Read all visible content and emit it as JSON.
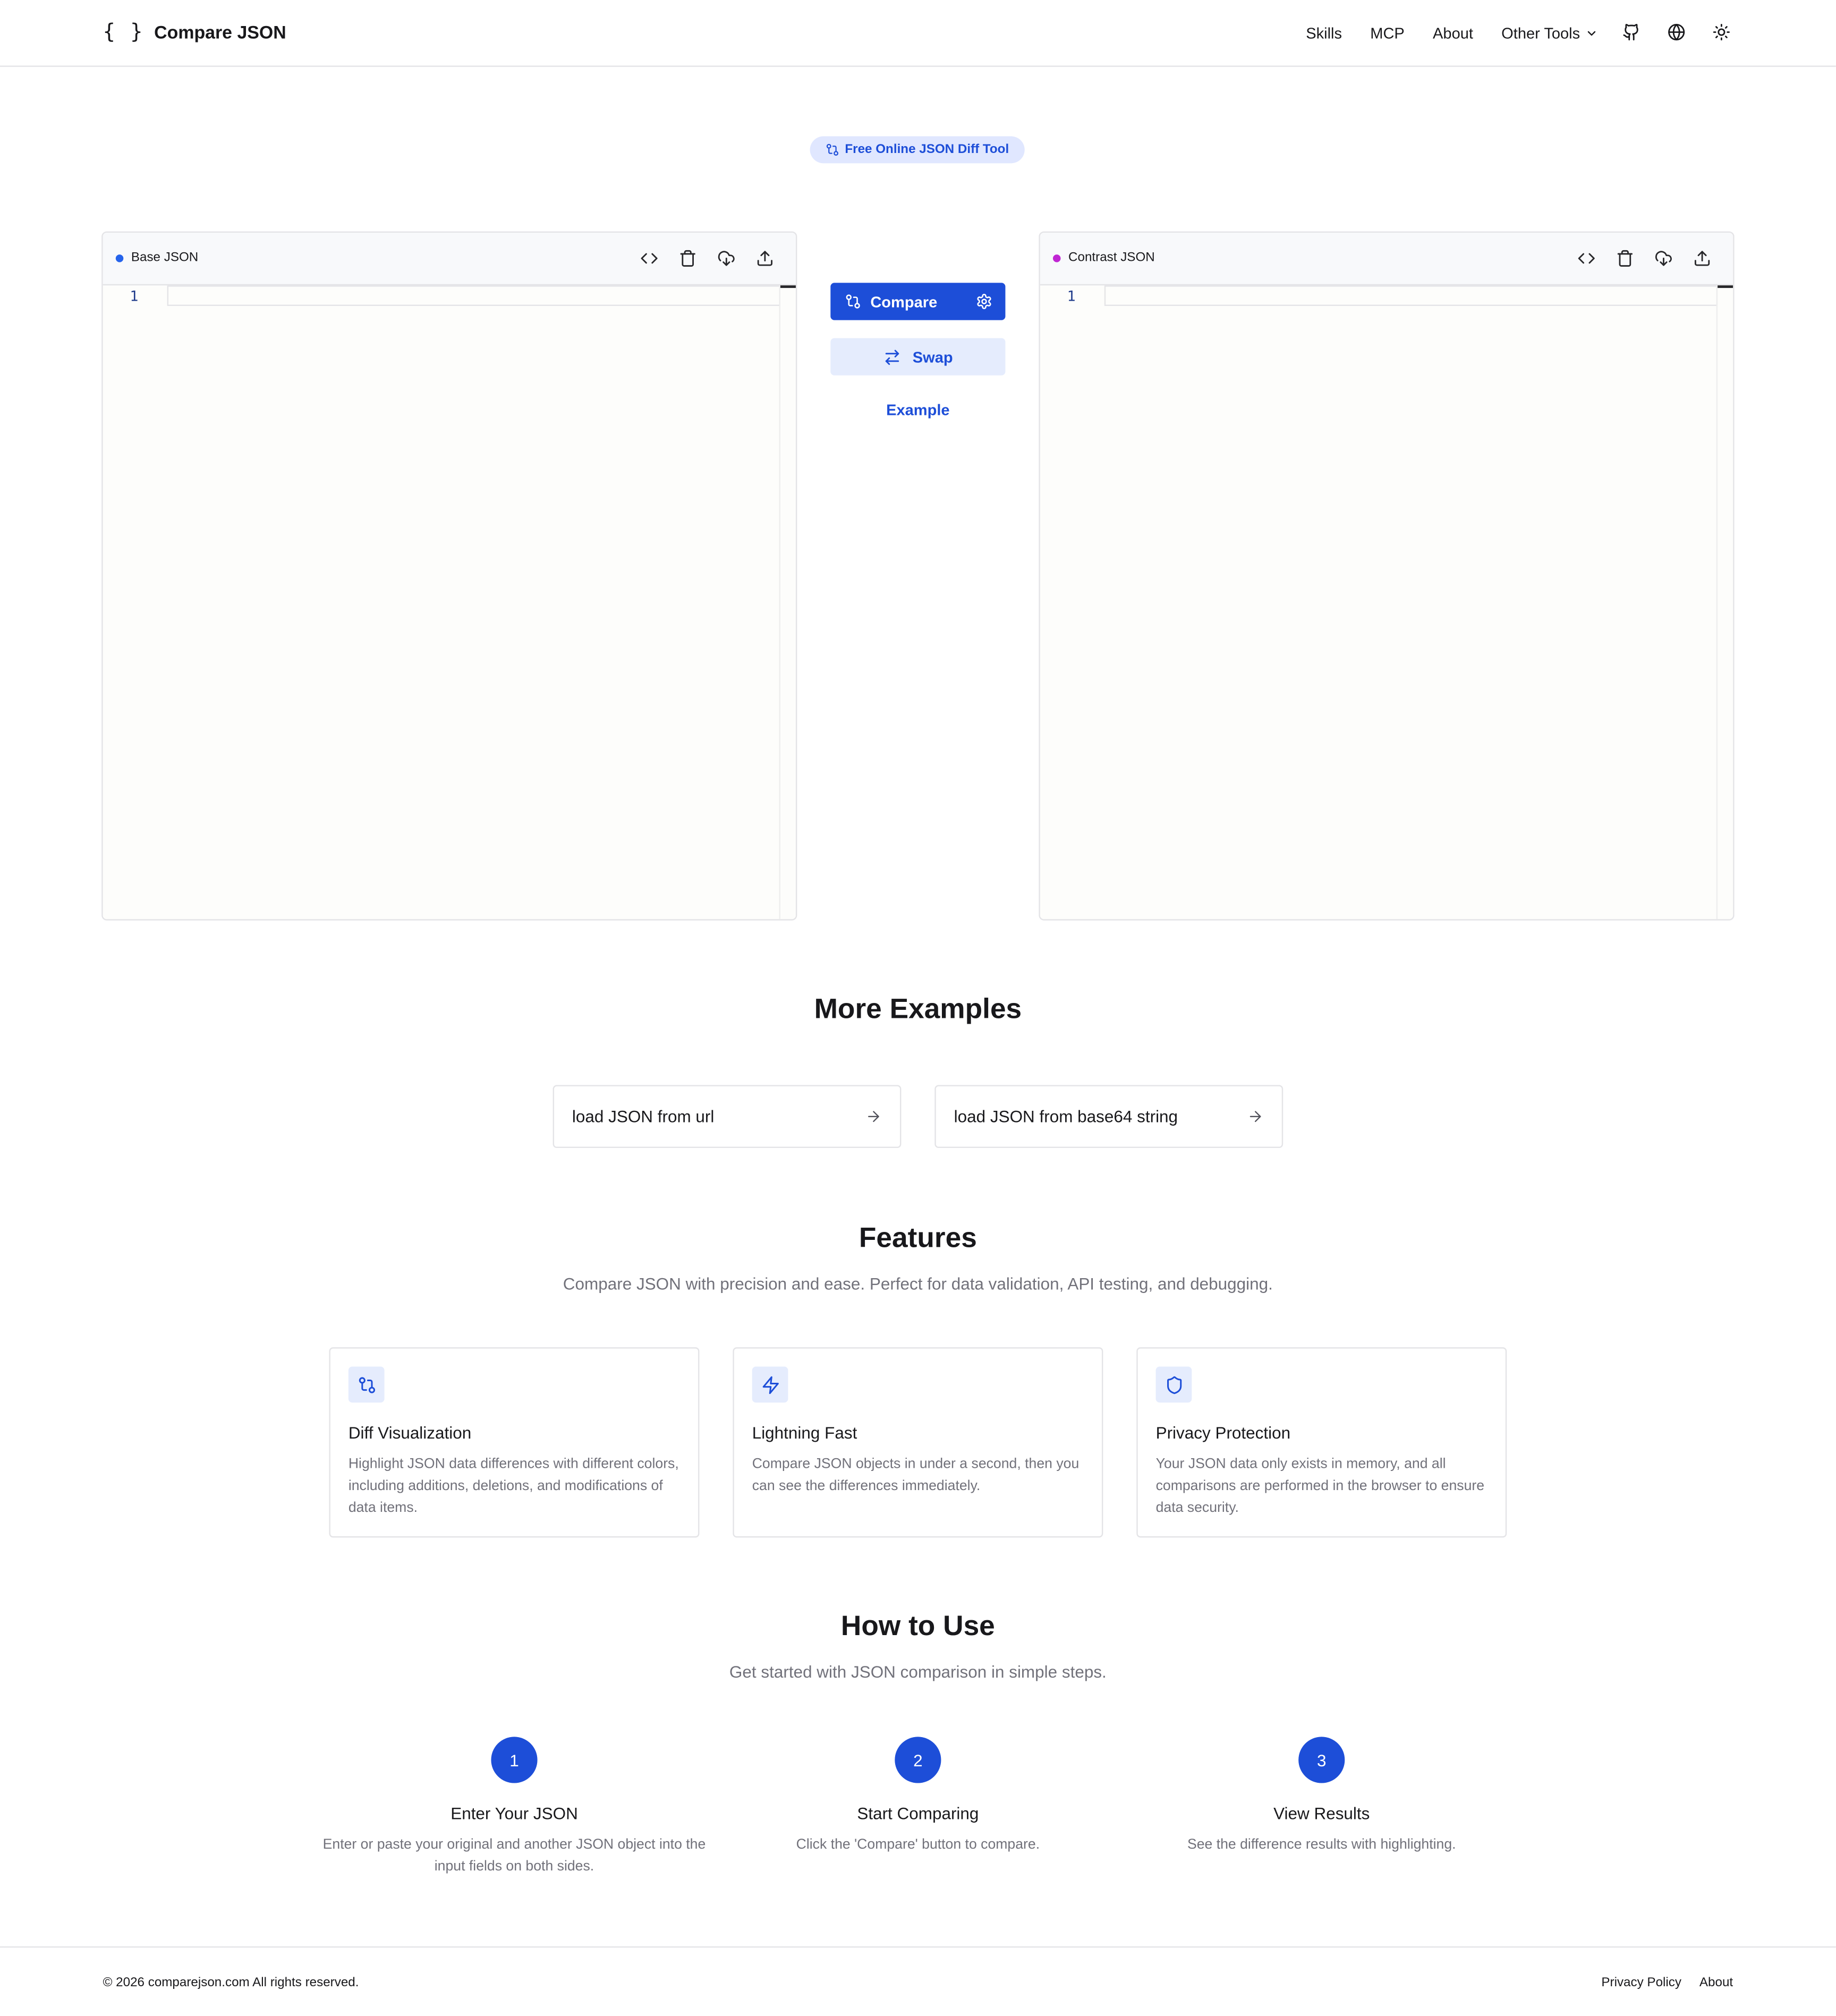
{
  "header": {
    "logo_glyph": "{ }",
    "brand_name": "Compare JSON",
    "nav": {
      "skills": "Skills",
      "mcp": "MCP",
      "about": "About",
      "other_tools": "Other Tools"
    },
    "icons": [
      "github-icon",
      "globe-icon",
      "sun-icon"
    ]
  },
  "badge": {
    "text": "Free Online JSON Diff Tool",
    "icon": "git-compare-icon"
  },
  "editors": {
    "base": {
      "title": "Base JSON",
      "dot_color": "#2563eb",
      "line_number": "1",
      "value": ""
    },
    "contrast": {
      "title": "Contrast JSON",
      "dot_color": "#c026d3",
      "line_number": "1",
      "value": ""
    },
    "tools": [
      "code-icon",
      "trash-icon",
      "cloud-download-icon",
      "upload-icon"
    ]
  },
  "actions": {
    "compare": "Compare",
    "swap": "Swap",
    "example": "Example"
  },
  "more_examples": {
    "title": "More Examples",
    "items": [
      "load JSON from url",
      "load JSON from base64 string"
    ]
  },
  "features": {
    "title": "Features",
    "subtitle": "Compare JSON with precision and ease. Perfect for data validation, API testing, and debugging.",
    "items": [
      {
        "icon": "git-compare-icon",
        "title": "Diff Visualization",
        "desc": "Highlight JSON data differences with different colors, including additions, deletions, and modifications of data items."
      },
      {
        "icon": "zap-icon",
        "title": "Lightning Fast",
        "desc": "Compare JSON objects in under a second, then you can see the differences immediately."
      },
      {
        "icon": "shield-icon",
        "title": "Privacy Protection",
        "desc": "Your JSON data only exists in memory, and all comparisons are performed in the browser to ensure data security."
      }
    ]
  },
  "how_to": {
    "title": "How to Use",
    "subtitle": "Get started with JSON comparison in simple steps.",
    "steps": [
      {
        "num": "1",
        "title": "Enter Your JSON",
        "desc": "Enter or paste your original and another JSON object into the input fields on both sides."
      },
      {
        "num": "2",
        "title": "Start Comparing",
        "desc": "Click the 'Compare' button to compare."
      },
      {
        "num": "3",
        "title": "View Results",
        "desc": "See the difference results with highlighting."
      }
    ]
  },
  "footer": {
    "copyright": "© 2026 comparejson.com All rights reserved.",
    "links": {
      "privacy": "Privacy Policy",
      "about": "About"
    }
  },
  "colors": {
    "accent": "#1d4ed8",
    "accent_soft": "#e5ecfd",
    "muted_text": "#71717a",
    "border": "#e4e4e7"
  }
}
